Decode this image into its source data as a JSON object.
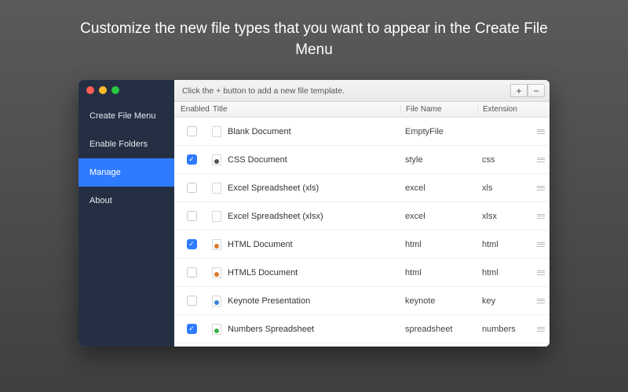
{
  "headline": "Customize the new file types that you want to appear in the Create File Menu",
  "sidebar": {
    "items": [
      {
        "label": "Create File Menu"
      },
      {
        "label": "Enable Folders"
      },
      {
        "label": "Manage"
      },
      {
        "label": "About"
      }
    ],
    "activeIndex": 2
  },
  "toolbar": {
    "hint": "Click the + button to add a new file template.",
    "add": "+",
    "remove": "−"
  },
  "columns": {
    "enabled": "Enabled",
    "title": "Title",
    "filename": "File Name",
    "extension": "Extension"
  },
  "rows": [
    {
      "enabled": false,
      "icon": "blank",
      "title": "Blank Document",
      "filename": "EmptyFile",
      "extension": ""
    },
    {
      "enabled": true,
      "icon": "css",
      "title": "CSS Document",
      "filename": "style",
      "extension": "css"
    },
    {
      "enabled": false,
      "icon": "blank",
      "title": "Excel Spreadsheet (xls)",
      "filename": "excel",
      "extension": "xls"
    },
    {
      "enabled": false,
      "icon": "blank",
      "title": "Excel Spreadsheet (xlsx)",
      "filename": "excel",
      "extension": "xlsx"
    },
    {
      "enabled": true,
      "icon": "html",
      "title": "HTML Document",
      "filename": "html",
      "extension": "html"
    },
    {
      "enabled": false,
      "icon": "html",
      "title": "HTML5 Document",
      "filename": "html",
      "extension": "html"
    },
    {
      "enabled": false,
      "icon": "key",
      "title": "Keynote Presentation",
      "filename": "keynote",
      "extension": "key"
    },
    {
      "enabled": true,
      "icon": "num",
      "title": "Numbers Spreadsheet",
      "filename": "spreadsheet",
      "extension": "numbers"
    }
  ]
}
